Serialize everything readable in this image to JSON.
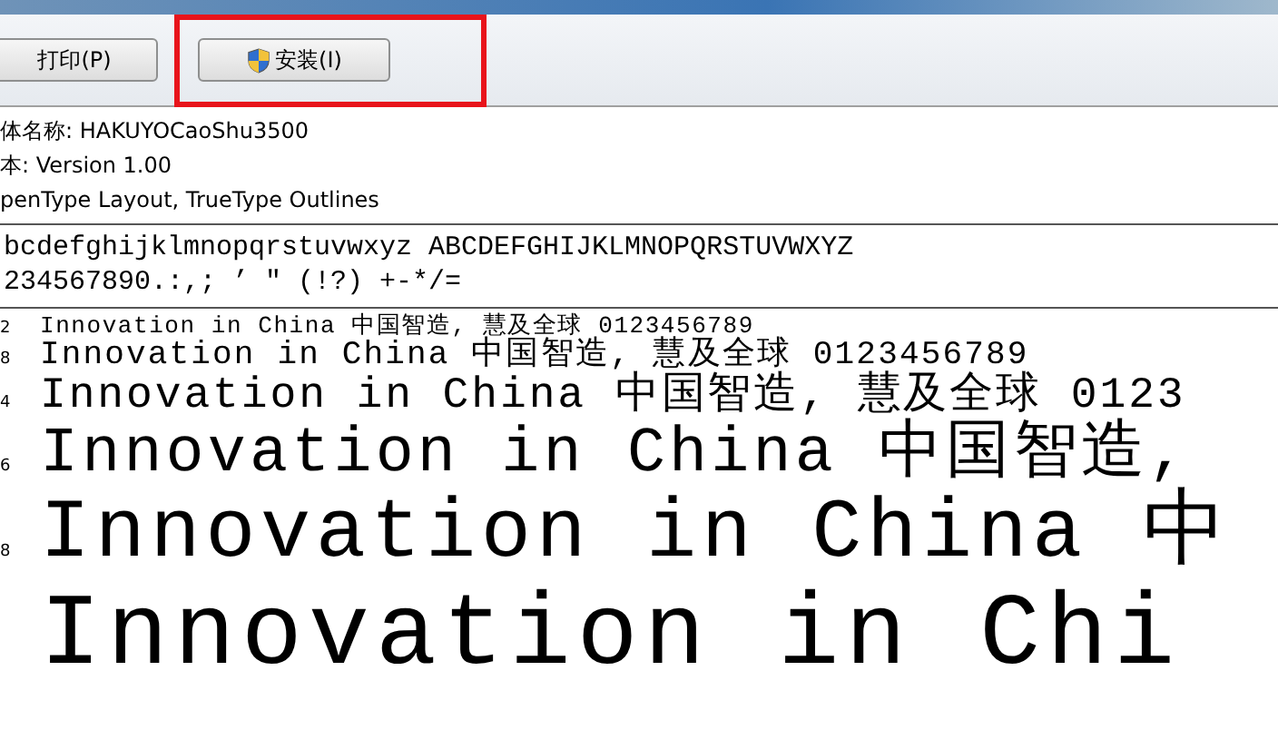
{
  "toolbar": {
    "buttons": [
      {
        "label": "打印(P)",
        "kind": "plain"
      },
      {
        "label": "安装(I)",
        "kind": "shield"
      }
    ]
  },
  "info": [
    "体名称: HAKUYOCaoShu3500",
    "本: Version 1.00",
    "penType Layout, TrueType Outlines"
  ],
  "charset": [
    "bcdefghijklmnopqrstuvwxyz ABCDEFGHIJKLMNOPQRSTUVWXYZ",
    "234567890.:,; ’ \" (!?) +-*/="
  ],
  "samples": [
    {
      "size": "2",
      "text": "Innovation in China 中国智造, 慧及全球 0123456789"
    },
    {
      "size": "8",
      "text": "Innovation in China 中国智造, 慧及全球 0123456789"
    },
    {
      "size": "4",
      "text": "Innovation in China 中国智造, 慧及全球 0123"
    },
    {
      "size": "6",
      "text": "Innovation in China 中国智造,"
    },
    {
      "size": "8",
      "text": "Innovation in China 中"
    },
    {
      "text": "Innovation in Chi"
    }
  ]
}
